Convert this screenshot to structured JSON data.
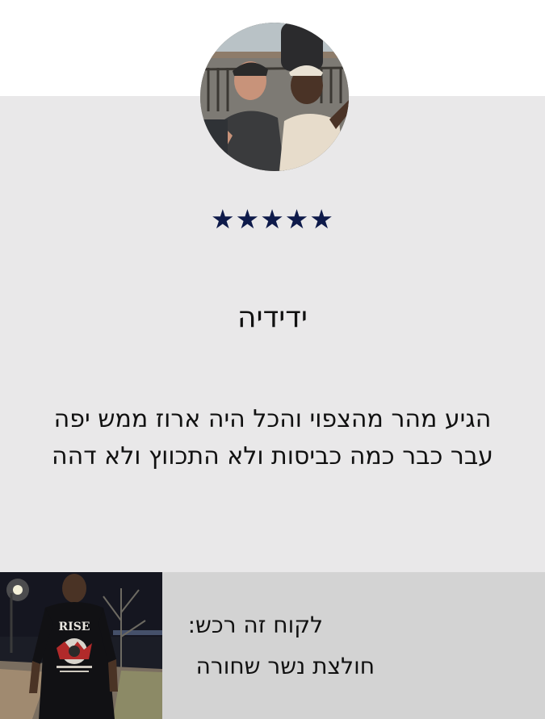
{
  "review": {
    "rating": 5,
    "stars": "★★★★★",
    "reviewer_name": "ידידיה",
    "text_line_1": "הגיע מהר מהצפוי והכל היה ארוז ממש יפה",
    "text_line_2": "עבר כבר כמה כביסות ולא התכווץ ולא דהה",
    "star_color": "#0e1a4a",
    "background_color": "#e9e8e9"
  },
  "purchase": {
    "label": "לקוח זה רכש:",
    "product_name": "חולצת נשר שחורה",
    "product_print_text": "RISE",
    "background_color": "#d3d3d3"
  }
}
